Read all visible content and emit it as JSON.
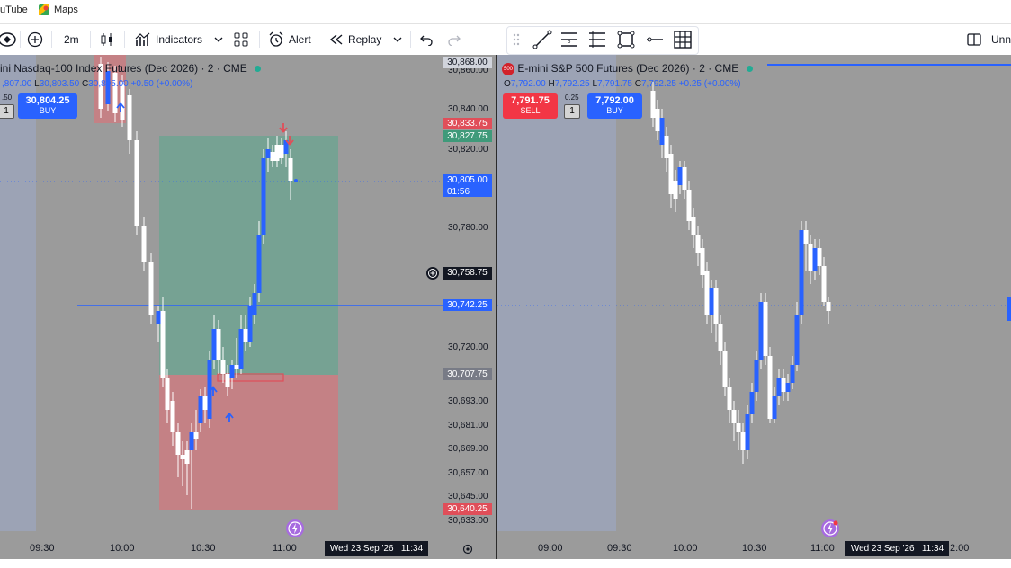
{
  "bookmarks": [
    {
      "label": "uTube",
      "icon": "youtube-icon"
    },
    {
      "label": "Maps",
      "icon": "maps-icon"
    }
  ],
  "toolbar": {
    "interval": "2m",
    "indicators_label": "Indicators",
    "alert_label": "Alert",
    "replay_label": "Replay",
    "layout_name": "Unn"
  },
  "left_chart": {
    "title": "ini Nasdaq-100 Index Futures (Dec 2026) · 2 · CME",
    "ohlc": {
      "o": ",807.00",
      "l_key": "L",
      "l": "30,803.50",
      "c_key": "C",
      "c": "30,805.00",
      "change": "+0.50 (+0.00%)"
    },
    "spread": ".50",
    "qty": "1",
    "buy_price": "30,804.25",
    "buy_label": "BUY",
    "price_ticks": [
      "30,860.00",
      "30,840.00",
      "30,820.00",
      "30,780.00",
      "30,720.00",
      "30,693.00",
      "30,681.00",
      "30,669.00",
      "30,657.00",
      "30,645.00",
      "30,633.00"
    ],
    "price_labels": {
      "high": "30,868.00",
      "stop_label": "30,833.75",
      "target_label": "30,827.75",
      "last_price": "30,805.00",
      "countdown": "01:56",
      "crosshair": "30,758.75",
      "hline": "30,742.25",
      "entry": "30,707.75",
      "low": "30,640.25"
    },
    "time_ticks": [
      "09:30",
      "10:00",
      "10:30",
      "11:00"
    ],
    "datetime": "Wed 23 Sep '26",
    "time": "11:34",
    "colors": {
      "up": "#ffffff",
      "down": "#2962ff",
      "profit": "#57a88d",
      "loss": "#e56b73"
    }
  },
  "right_chart": {
    "badge": "500",
    "title": "E-mini S&P 500 Futures (Dec 2026) · 2 · CME",
    "ohlc": {
      "o_key": "O",
      "o": "7,792.00",
      "h_key": "H",
      "h": "7,792.25",
      "l_key": "L",
      "l": "7,791.75",
      "c_key": "C",
      "c": "7,792.25",
      "change": "+0.25 (+0.00%)"
    },
    "sell_price": "7,791.75",
    "sell_label": "SELL",
    "spread": "0.25",
    "qty": "1",
    "buy_price": "7,792.00",
    "buy_label": "BUY",
    "time_ticks": [
      "09:00",
      "09:30",
      "10:00",
      "10:30",
      "11:00",
      "2:00"
    ],
    "datetime": "Wed 23 Sep '26",
    "time": "11:34"
  }
}
